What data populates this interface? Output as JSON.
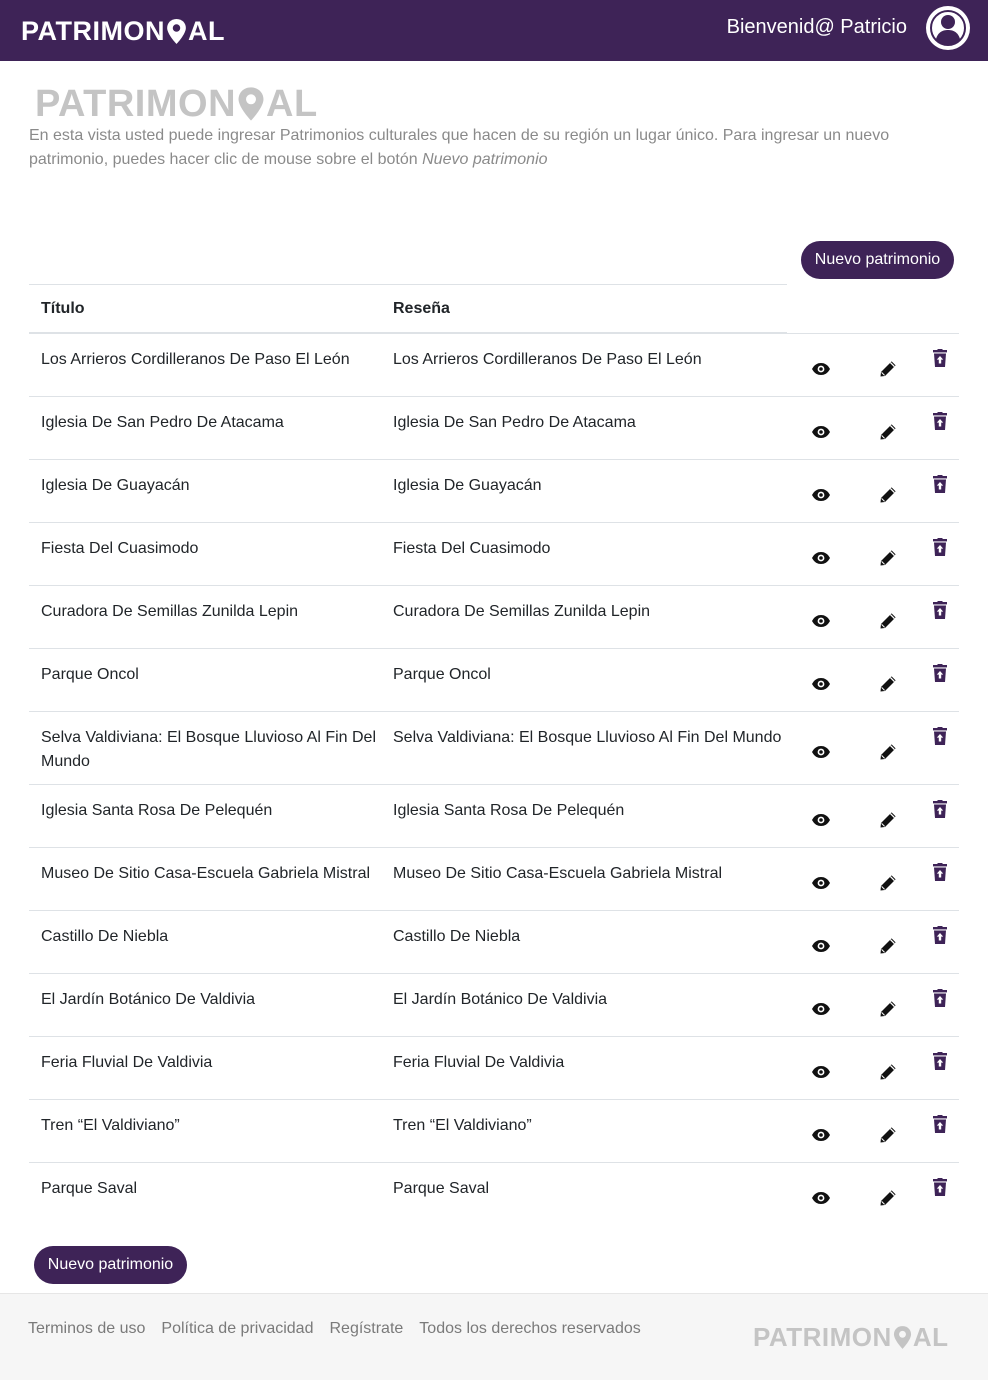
{
  "header": {
    "brand_pre": "PATRIMON",
    "brand_post": "AL",
    "welcome": "Bienvenid@ Patricio"
  },
  "intro": {
    "logo_pre": "PATRIMON",
    "logo_post": "AL",
    "text": "En esta vista usted puede ingresar Patrimonios culturales que hacen de su región un lugar único. Para ingresar un nuevo patrimonio, puedes hacer clic de mouse sobre el botón ",
    "text_em": "Nuevo patrimonio"
  },
  "actions": {
    "new_top": "Nuevo patrimonio",
    "new_bottom": "Nuevo patrimonio"
  },
  "table": {
    "headers": {
      "title": "Título",
      "review": "Reseña"
    },
    "rows": [
      {
        "title": "Los Arrieros Cordilleranos De Paso El León",
        "review": "Los Arrieros Cordilleranos De Paso El León"
      },
      {
        "title": "Iglesia De San Pedro De Atacama",
        "review": "Iglesia De San Pedro De Atacama"
      },
      {
        "title": "Iglesia De Guayacán",
        "review": "Iglesia De Guayacán"
      },
      {
        "title": "Fiesta Del Cuasimodo",
        "review": "Fiesta Del Cuasimodo"
      },
      {
        "title": "Curadora De Semillas Zunilda Lepin",
        "review": "Curadora De Semillas Zunilda Lepin"
      },
      {
        "title": "Parque Oncol",
        "review": "Parque Oncol"
      },
      {
        "title": "Selva Valdiviana: El Bosque Lluvioso Al Fin Del Mundo",
        "review": "Selva Valdiviana: El Bosque Lluvioso Al Fin Del Mundo"
      },
      {
        "title": "Iglesia Santa Rosa De Pelequén",
        "review": "Iglesia Santa Rosa De Pelequén"
      },
      {
        "title": "Museo De Sitio Casa-Escuela Gabriela Mistral",
        "review": "Museo De Sitio Casa-Escuela Gabriela Mistral"
      },
      {
        "title": "Castillo De Niebla",
        "review": "Castillo De Niebla"
      },
      {
        "title": "El Jardín Botánico De Valdivia",
        "review": "El Jardín Botánico De Valdivia"
      },
      {
        "title": "Feria Fluvial De Valdivia",
        "review": "Feria Fluvial De Valdivia"
      },
      {
        "title": "Tren “El Valdiviano”",
        "review": "Tren “El Valdiviano”"
      },
      {
        "title": "Parque Saval",
        "review": "Parque Saval"
      }
    ]
  },
  "footer": {
    "terms": "Terminos de uso",
    "privacy": "Política de privacidad",
    "register": "Regístrate",
    "rights": "Todos los derechos reservados",
    "logo_pre": "PATRIMON",
    "logo_post": "AL"
  },
  "colors": {
    "brand": "#3e2357",
    "muted_text": "#8a8a8a",
    "logo_grey": "#c4c4c4"
  },
  "icons": {
    "row_view": "eye-icon",
    "row_edit": "pencil-icon",
    "row_delete": "trash-restore-icon",
    "avatar": "user-circle-icon",
    "logo_pin": "map-pin-icon"
  }
}
